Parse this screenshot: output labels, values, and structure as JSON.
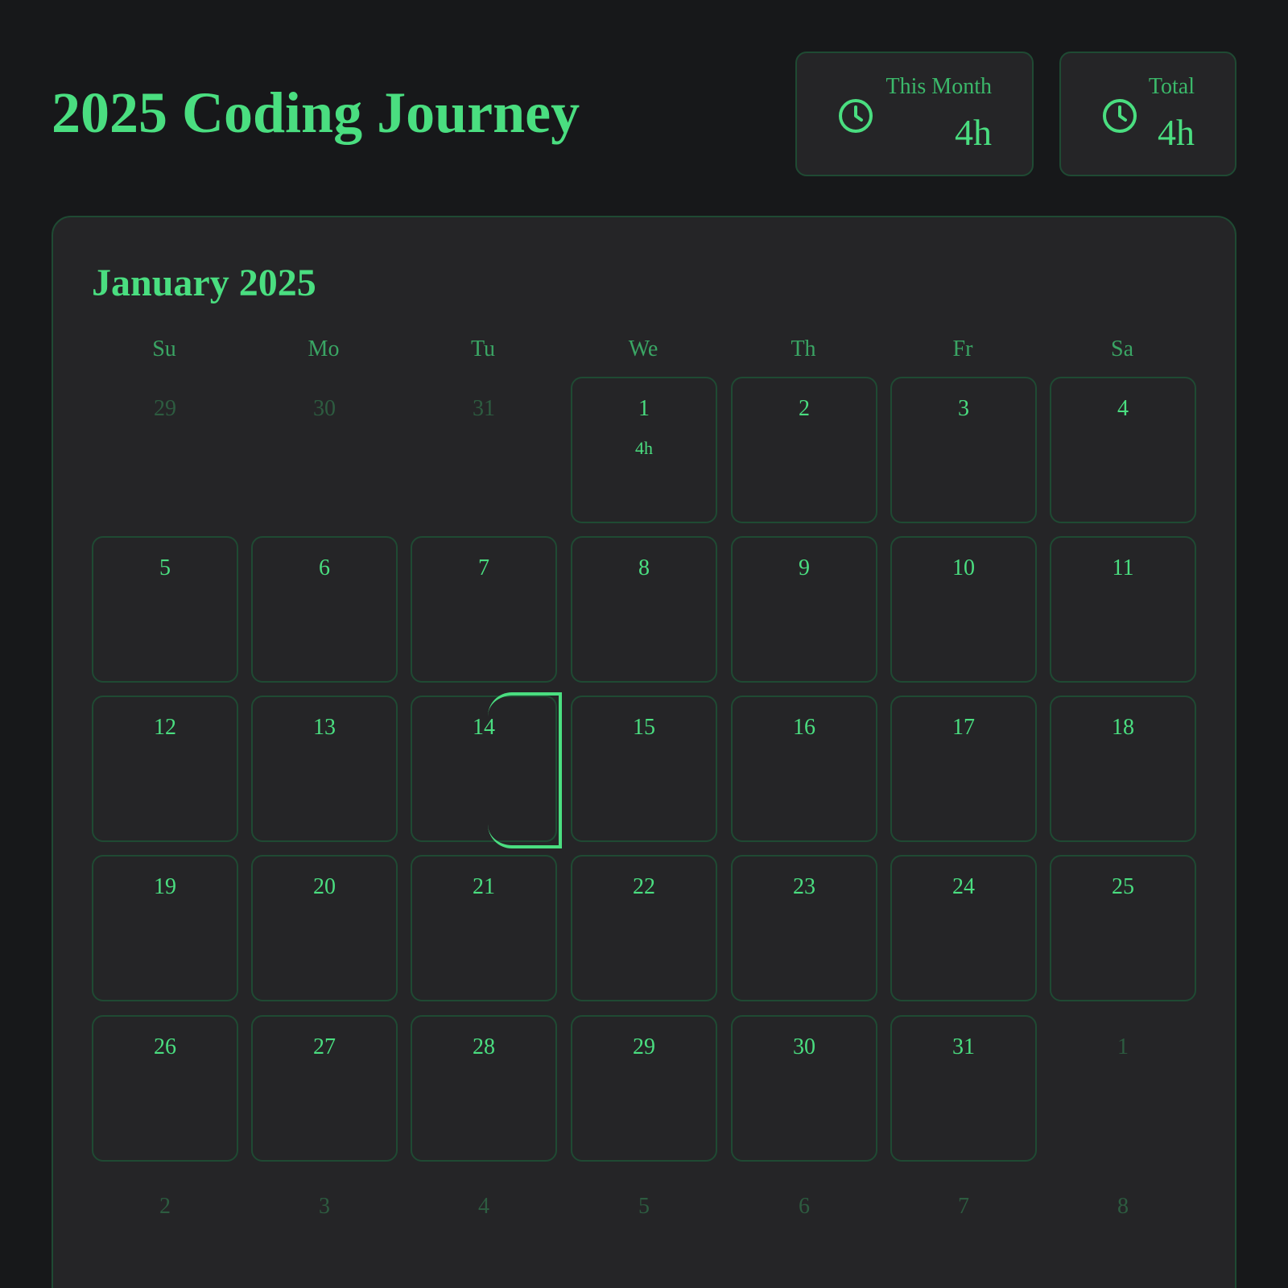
{
  "header": {
    "title": "2025 Coding Journey"
  },
  "stats": {
    "this_month": {
      "label": "This Month",
      "value": "4h",
      "icon": "clock-icon"
    },
    "total": {
      "label": "Total",
      "value": "4h",
      "icon": "clock-icon"
    }
  },
  "calendar": {
    "month_title": "January 2025",
    "weekdays": [
      "Su",
      "Mo",
      "Tu",
      "We",
      "Th",
      "Fr",
      "Sa"
    ],
    "today": "14",
    "weeks": [
      [
        {
          "day": "29",
          "current": false,
          "hours": ""
        },
        {
          "day": "30",
          "current": false,
          "hours": ""
        },
        {
          "day": "31",
          "current": false,
          "hours": ""
        },
        {
          "day": "1",
          "current": true,
          "hours": "4h"
        },
        {
          "day": "2",
          "current": true,
          "hours": ""
        },
        {
          "day": "3",
          "current": true,
          "hours": ""
        },
        {
          "day": "4",
          "current": true,
          "hours": ""
        }
      ],
      [
        {
          "day": "5",
          "current": true,
          "hours": ""
        },
        {
          "day": "6",
          "current": true,
          "hours": ""
        },
        {
          "day": "7",
          "current": true,
          "hours": ""
        },
        {
          "day": "8",
          "current": true,
          "hours": ""
        },
        {
          "day": "9",
          "current": true,
          "hours": ""
        },
        {
          "day": "10",
          "current": true,
          "hours": ""
        },
        {
          "day": "11",
          "current": true,
          "hours": ""
        }
      ],
      [
        {
          "day": "12",
          "current": true,
          "hours": ""
        },
        {
          "day": "13",
          "current": true,
          "hours": ""
        },
        {
          "day": "14",
          "current": true,
          "hours": ""
        },
        {
          "day": "15",
          "current": true,
          "hours": ""
        },
        {
          "day": "16",
          "current": true,
          "hours": ""
        },
        {
          "day": "17",
          "current": true,
          "hours": ""
        },
        {
          "day": "18",
          "current": true,
          "hours": ""
        }
      ],
      [
        {
          "day": "19",
          "current": true,
          "hours": ""
        },
        {
          "day": "20",
          "current": true,
          "hours": ""
        },
        {
          "day": "21",
          "current": true,
          "hours": ""
        },
        {
          "day": "22",
          "current": true,
          "hours": ""
        },
        {
          "day": "23",
          "current": true,
          "hours": ""
        },
        {
          "day": "24",
          "current": true,
          "hours": ""
        },
        {
          "day": "25",
          "current": true,
          "hours": ""
        }
      ],
      [
        {
          "day": "26",
          "current": true,
          "hours": ""
        },
        {
          "day": "27",
          "current": true,
          "hours": ""
        },
        {
          "day": "28",
          "current": true,
          "hours": ""
        },
        {
          "day": "29",
          "current": true,
          "hours": ""
        },
        {
          "day": "30",
          "current": true,
          "hours": ""
        },
        {
          "day": "31",
          "current": true,
          "hours": ""
        },
        {
          "day": "1",
          "current": false,
          "hours": ""
        }
      ],
      [
        {
          "day": "2",
          "current": false,
          "hours": ""
        },
        {
          "day": "3",
          "current": false,
          "hours": ""
        },
        {
          "day": "4",
          "current": false,
          "hours": ""
        },
        {
          "day": "5",
          "current": false,
          "hours": ""
        },
        {
          "day": "6",
          "current": false,
          "hours": ""
        },
        {
          "day": "7",
          "current": false,
          "hours": ""
        },
        {
          "day": "8",
          "current": false,
          "hours": ""
        }
      ]
    ]
  },
  "colors": {
    "background": "#17181a",
    "card": "#252527",
    "accent": "#4ade80",
    "border": "#1f4a33",
    "muted": "#2d5c40"
  }
}
